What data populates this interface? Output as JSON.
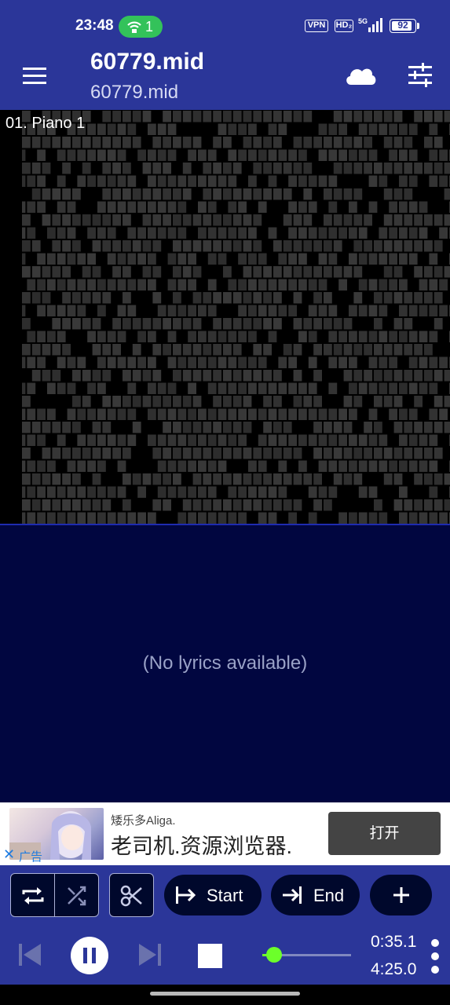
{
  "status_bar": {
    "time": "23:48",
    "hotspot_count": "1",
    "vpn_label": "VPN",
    "hd_label": "HD₂",
    "network_label": "5G",
    "battery_level": "92",
    "icons": [
      "hotspot-icon",
      "signal-icon",
      "battery-icon"
    ]
  },
  "app_bar": {
    "title": "60779.mid",
    "subtitle": "60779.mid",
    "icons": [
      "menu-icon",
      "cloud-icon",
      "tune-icon"
    ]
  },
  "track": {
    "name": "01. Piano 1"
  },
  "lyrics": {
    "message": "(No lyrics available)"
  },
  "ad": {
    "brand": "矮乐多Aliga.",
    "headline": "老司机.资源浏览器.",
    "open_label": "打开",
    "close_glyph": "✕",
    "ad_label": "广告"
  },
  "controls": {
    "start_label": "Start",
    "end_label": "End",
    "icons": [
      "repeat-icon",
      "shuffle-icon",
      "scissors-icon",
      "jump-start-icon",
      "jump-end-icon",
      "plus-icon",
      "skip-previous-icon",
      "pause-icon",
      "skip-next-icon",
      "stop-icon",
      "more-vert-icon"
    ],
    "progress_fraction": 0.137,
    "time_elapsed": "0:35.1",
    "time_total": "4:25.0"
  },
  "colors": {
    "app_bar": "#2b3699",
    "lyrics_bg": "#010640",
    "progress_accent": "#6cff2a",
    "hotspot_green": "#33c25a"
  }
}
